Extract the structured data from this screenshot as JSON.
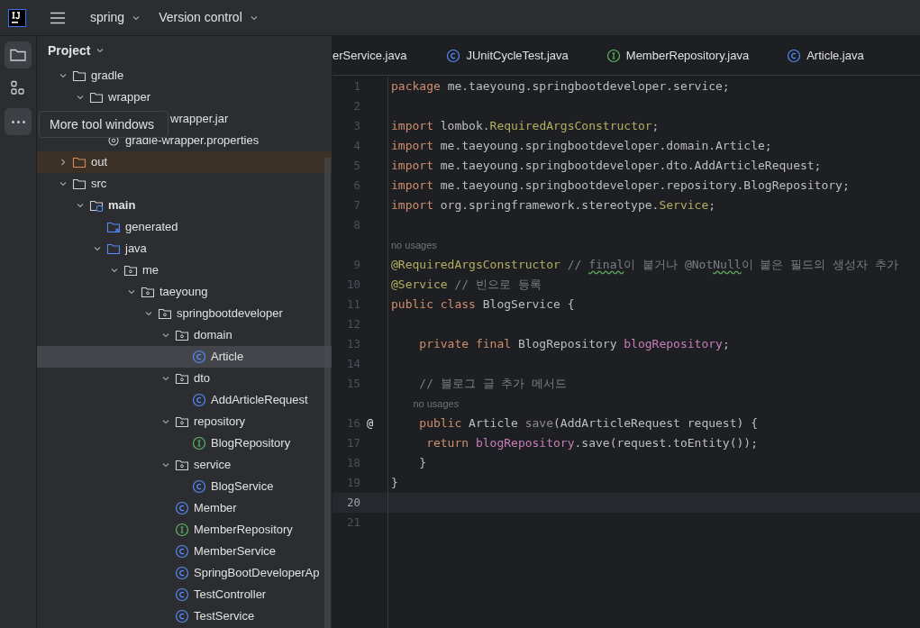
{
  "title_bar": {
    "project": "spring",
    "vcs": "Version control"
  },
  "tool_strip": [
    {
      "kind": "folder",
      "selected": true
    },
    {
      "kind": "structure",
      "selected": false
    },
    {
      "kind": "more",
      "selected": true
    }
  ],
  "tooltip": "More tool windows",
  "project_panel": {
    "title": "Project",
    "tree": [
      {
        "label": "gradle",
        "kind": "folder",
        "expanded": true,
        "selected": false,
        "children": [
          {
            "label": "wrapper",
            "kind": "folder",
            "expanded": true,
            "selected": false,
            "children": [
              {
                "label": "wrapper.jar",
                "kind": "covered",
                "selected": false
              },
              {
                "label": "gradle-wrapper.properties",
                "kind": "settings-file",
                "selected": false
              }
            ]
          }
        ]
      },
      {
        "label": "out",
        "kind": "excluded-folder",
        "expanded": false,
        "selected": false
      },
      {
        "label": "src",
        "kind": "folder",
        "expanded": true,
        "selected": false,
        "children": [
          {
            "label": "main",
            "kind": "source-root",
            "expanded": true,
            "selected": false,
            "children": [
              {
                "label": "generated",
                "kind": "generated-folder",
                "selected": false
              },
              {
                "label": "java",
                "kind": "blue-folder",
                "expanded": true,
                "selected": false,
                "children": [
                  {
                    "label": "me",
                    "kind": "package",
                    "expanded": true,
                    "selected": false,
                    "children": [
                      {
                        "label": "taeyoung",
                        "kind": "package",
                        "expanded": true,
                        "selected": false,
                        "children": [
                          {
                            "label": "springbootdeveloper",
                            "kind": "package",
                            "expanded": true,
                            "selected": false,
                            "children": [
                              {
                                "label": "domain",
                                "kind": "package",
                                "expanded": true,
                                "selected": false,
                                "children": [
                                  {
                                    "label": "Article",
                                    "kind": "class",
                                    "selected": true
                                  }
                                ]
                              },
                              {
                                "label": "dto",
                                "kind": "package",
                                "expanded": true,
                                "selected": false,
                                "children": [
                                  {
                                    "label": "AddArticleRequest",
                                    "kind": "class",
                                    "selected": false
                                  }
                                ]
                              },
                              {
                                "label": "repository",
                                "kind": "package",
                                "expanded": true,
                                "selected": false,
                                "children": [
                                  {
                                    "label": "BlogRepository",
                                    "kind": "interface",
                                    "selected": false
                                  }
                                ]
                              },
                              {
                                "label": "service",
                                "kind": "package",
                                "expanded": true,
                                "selected": false,
                                "children": [
                                  {
                                    "label": "BlogService",
                                    "kind": "class",
                                    "selected": false
                                  }
                                ]
                              },
                              {
                                "label": "Member",
                                "kind": "class",
                                "selected": false
                              },
                              {
                                "label": "MemberRepository",
                                "kind": "interface",
                                "selected": false
                              },
                              {
                                "label": "MemberService",
                                "kind": "class",
                                "selected": false
                              },
                              {
                                "label": "SpringBootDeveloperAp",
                                "kind": "class",
                                "selected": false
                              },
                              {
                                "label": "TestController",
                                "kind": "class",
                                "selected": false
                              },
                              {
                                "label": "TestService",
                                "kind": "class",
                                "selected": false
                              }
                            ]
                          }
                        ]
                      }
                    ]
                  }
                ]
              }
            ]
          }
        ]
      }
    ]
  },
  "tabs": [
    {
      "label": "erService.java",
      "kind": "cut",
      "selected": false
    },
    {
      "label": "JUnitCycleTest.java",
      "kind": "class",
      "selected": false
    },
    {
      "label": "MemberRepository.java",
      "kind": "interface",
      "selected": false
    },
    {
      "label": "Article.java",
      "kind": "class",
      "selected": false
    }
  ],
  "editor": {
    "lines": [
      {
        "number": "1",
        "current": false,
        "tokens": [
          {
            "kind": "keyword",
            "text": "package "
          },
          {
            "kind": "plain",
            "text": "me.taeyoung.springbootdeveloper.service;"
          }
        ]
      },
      {
        "number": "2",
        "current": false
      },
      {
        "number": "3",
        "current": false,
        "tokens": [
          {
            "kind": "keyword",
            "text": "import "
          },
          {
            "kind": "plain",
            "text": "lombok."
          },
          {
            "kind": "annotation",
            "text": "RequiredArgsConstructor"
          },
          {
            "kind": "plain",
            "text": ";"
          }
        ]
      },
      {
        "number": "4",
        "current": false,
        "tokens": [
          {
            "kind": "keyword",
            "text": "import "
          },
          {
            "kind": "plain",
            "text": "me.taeyoung.springbootdeveloper.domain.Article;"
          }
        ]
      },
      {
        "number": "5",
        "current": false,
        "tokens": [
          {
            "kind": "keyword",
            "text": "import "
          },
          {
            "kind": "plain",
            "text": "me.taeyoung.springbootdeveloper.dto.AddArticleRequest;"
          }
        ]
      },
      {
        "number": "6",
        "current": false,
        "tokens": [
          {
            "kind": "keyword",
            "text": "import "
          },
          {
            "kind": "plain",
            "text": "me.taeyoung.springbootdeveloper.repository.BlogRepository;"
          }
        ]
      },
      {
        "number": "7",
        "current": false,
        "tokens": [
          {
            "kind": "keyword",
            "text": "import "
          },
          {
            "kind": "plain",
            "text": "org.springframework.stereotype."
          },
          {
            "kind": "annotation",
            "text": "Service"
          },
          {
            "kind": "plain",
            "text": ";"
          }
        ]
      },
      {
        "number": "8",
        "current": false
      },
      {
        "hint": "no usages"
      },
      {
        "number": "9",
        "current": false,
        "tokens": [
          {
            "kind": "annotation",
            "text": "@RequiredArgsConstructor "
          },
          {
            "kind": "comment",
            "text": "// "
          },
          {
            "kind": "typo",
            "text": "final"
          },
          {
            "kind": "comment",
            "text": "이 붙거나 @Not"
          },
          {
            "kind": "typo",
            "text": "Null"
          },
          {
            "kind": "comment",
            "text": "이 붙은 필드의 생성자 추가"
          }
        ]
      },
      {
        "number": "10",
        "current": false,
        "tokens": [
          {
            "kind": "annotation",
            "text": "@Service "
          },
          {
            "kind": "comment",
            "text": "// 빈으로 등록"
          }
        ]
      },
      {
        "number": "11",
        "current": false,
        "tokens": [
          {
            "kind": "keyword",
            "text": "public class "
          },
          {
            "kind": "plain",
            "text": "BlogService {"
          }
        ]
      },
      {
        "number": "12",
        "current": false
      },
      {
        "number": "13",
        "current": false,
        "tokens": [
          {
            "kind": "keyword",
            "text": "    private final "
          },
          {
            "kind": "plain",
            "text": "BlogRepository "
          },
          {
            "kind": "field",
            "text": "blogRepository"
          },
          {
            "kind": "plain",
            "text": ";"
          }
        ]
      },
      {
        "number": "14",
        "current": false
      },
      {
        "number": "15",
        "current": false,
        "tokens": [
          {
            "kind": "comment",
            "text": "    // 블로그 글 추가 메서드"
          }
        ]
      },
      {
        "hint": "    no usages"
      },
      {
        "number": "16",
        "current": false,
        "gutter": "@",
        "tokens": [
          {
            "kind": "keyword",
            "text": "    public "
          },
          {
            "kind": "plain",
            "text": "Article "
          },
          {
            "kind": "unused",
            "text": "save"
          },
          {
            "kind": "plain",
            "text": "(AddArticleRequest request) {"
          }
        ]
      },
      {
        "number": "17",
        "current": false,
        "tokens": [
          {
            "kind": "keyword",
            "text": "     return "
          },
          {
            "kind": "field",
            "text": "blogRepository"
          },
          {
            "kind": "plain",
            "text": ".save(request.toEntity());"
          }
        ]
      },
      {
        "number": "18",
        "current": false,
        "tokens": [
          {
            "kind": "plain",
            "text": "    }"
          }
        ]
      },
      {
        "number": "19",
        "current": false,
        "tokens": [
          {
            "kind": "plain",
            "text": "}"
          }
        ]
      },
      {
        "number": "20",
        "current": true
      },
      {
        "number": "21",
        "current": false
      }
    ]
  }
}
